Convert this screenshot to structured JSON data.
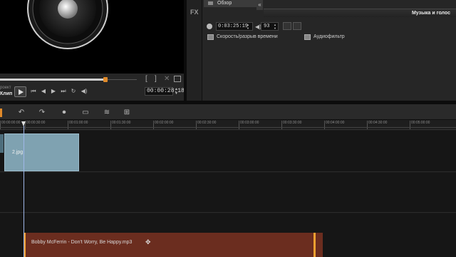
{
  "player": {
    "project_label": "роект",
    "clip_label": "Клип",
    "mark_in": "[",
    "mark_out": "]",
    "timecode": "00:00:28:18",
    "scrub_progress": 0.77
  },
  "options": {
    "fx_label": "FX",
    "browse_label": "Обзор",
    "collapse_glyph": "«",
    "tab_label": "Музыка и голос",
    "duration": "0:03:25:19",
    "volume": "93",
    "speed_label": "Скорость/разрыв времени",
    "filter_label": "Аудиофильтр"
  },
  "ruler": {
    "ticks": [
      "00:00:00:00",
      "00:00:30:00",
      "00:01:00:00",
      "00:01:30:00",
      "00:02:00:00",
      "00:02:30:00",
      "00:03:00:00",
      "00:03:30:00",
      "00:04:00:00",
      "00:04:30:00",
      "00:05:00:00"
    ]
  },
  "timeline": {
    "image_clip_label": "2.jpg",
    "audio_clip_label": "Bobby McFerrin - Don't Worry, Be Happy.mp3"
  },
  "colors": {
    "accent": "#e08a2a",
    "image_clip": "#7fa2b1",
    "audio_clip": "#6b2d1f",
    "playhead": "#9fb7e8"
  }
}
